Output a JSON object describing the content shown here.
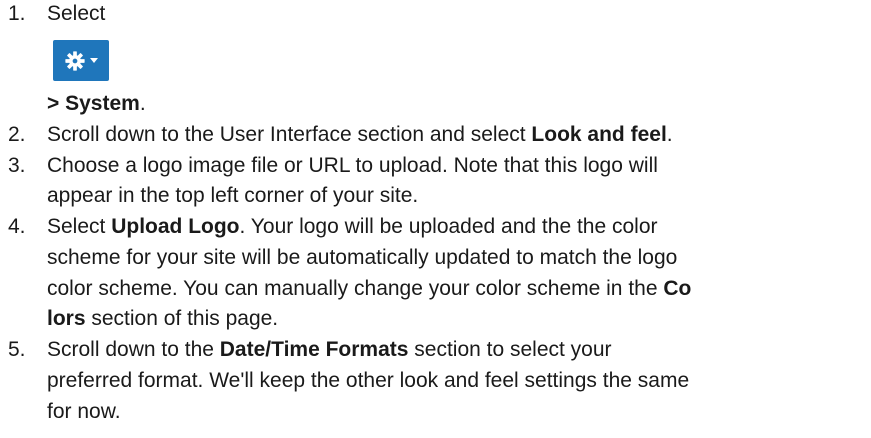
{
  "steps": [
    {
      "number": "1.",
      "select_label": "Select",
      "button_icon": "gear-icon",
      "button_color": "#1f76bb",
      "path_suffix": "> System",
      "period": "."
    },
    {
      "number": "2.",
      "text_before": "Scroll down to the User Interface section and select ",
      "bold": "Look and feel",
      "text_after": "."
    },
    {
      "number": "3.",
      "line1": "Choose a logo image file or URL to upload. Note that this logo will",
      "line2": "appear in the top left corner of your site."
    },
    {
      "number": "4.",
      "bold1": "Upload Logo",
      "text1": "Select ",
      "text2": ". Your logo will be uploaded and the the color",
      "line2": "scheme for your site will be automatically updated to match the logo",
      "line3_text": "color scheme. You can manually change your color scheme in the ",
      "line3_bold": "Co",
      "line4_bold": "lors",
      "line4_text": " section of this page."
    },
    {
      "number": "5.",
      "text1": "Scroll down to the ",
      "bold1": "Date/Time Formats",
      "text2": " section to select your",
      "line2": "preferred format. We'll keep the other look and feel settings the same",
      "line3": "for now."
    }
  ]
}
